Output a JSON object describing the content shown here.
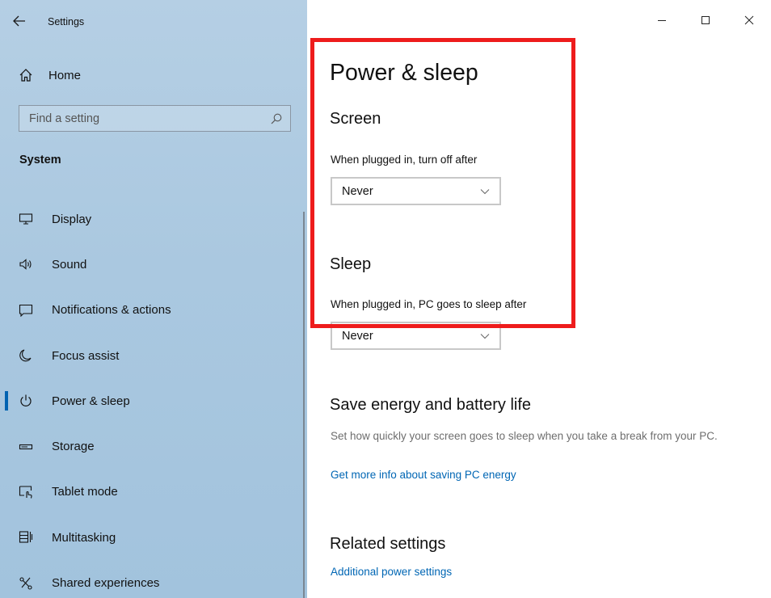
{
  "window": {
    "title": "Settings",
    "controls": {
      "minimize": "minimize",
      "maximize": "maximize",
      "close": "close"
    }
  },
  "sidebar": {
    "home_label": "Home",
    "search_placeholder": "Find a setting",
    "section_title": "System",
    "items": [
      {
        "label": "Display",
        "icon": "monitor-icon",
        "active": false
      },
      {
        "label": "Sound",
        "icon": "speaker-icon",
        "active": false
      },
      {
        "label": "Notifications & actions",
        "icon": "notification-icon",
        "active": false
      },
      {
        "label": "Focus assist",
        "icon": "moon-icon",
        "active": false
      },
      {
        "label": "Power & sleep",
        "icon": "power-icon",
        "active": true
      },
      {
        "label": "Storage",
        "icon": "storage-icon",
        "active": false
      },
      {
        "label": "Tablet mode",
        "icon": "tablet-mode-icon",
        "active": false
      },
      {
        "label": "Multitasking",
        "icon": "multitasking-icon",
        "active": false
      },
      {
        "label": "Shared experiences",
        "icon": "shared-experiences-icon",
        "active": false
      }
    ]
  },
  "main": {
    "title": "Power & sleep",
    "screen": {
      "heading": "Screen",
      "plugged_label": "When plugged in, turn off after",
      "plugged_value": "Never"
    },
    "sleep": {
      "heading": "Sleep",
      "plugged_label": "When plugged in, PC goes to sleep after",
      "plugged_value": "Never"
    },
    "save_energy": {
      "heading": "Save energy and battery life",
      "description": "Set how quickly your screen goes to sleep when you take a break from your PC.",
      "link": "Get more info about saving PC energy"
    },
    "related": {
      "heading": "Related settings",
      "link": "Additional power settings"
    }
  },
  "colors": {
    "accent": "#0063b1",
    "link": "#0066b4",
    "highlight_border": "#ee1c1c",
    "sidebar_bg": "#aac8e0"
  }
}
